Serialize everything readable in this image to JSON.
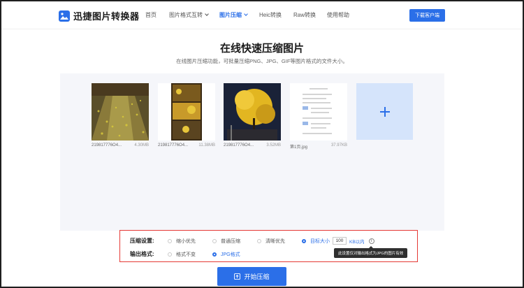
{
  "brand": {
    "name": "迅捷图片转换器",
    "accent": "#2b6fe8"
  },
  "nav": {
    "items": [
      {
        "label": "首页",
        "active": false,
        "dropdown": false
      },
      {
        "label": "图片格式互转",
        "active": false,
        "dropdown": true
      },
      {
        "label": "图片压缩",
        "active": true,
        "dropdown": true
      },
      {
        "label": "Heic转换",
        "active": false,
        "dropdown": false
      },
      {
        "label": "Raw转换",
        "active": false,
        "dropdown": false
      },
      {
        "label": "使用帮助",
        "active": false,
        "dropdown": false
      }
    ],
    "download_label": "下载客户端"
  },
  "main": {
    "title": "在线快速压缩图片",
    "subtitle": "在线图片压缩功能，可批量压缩PNG、JPG、GIF等图片格式的文件大小。"
  },
  "files": [
    {
      "name": "219817776O4...",
      "size": "4.30MB"
    },
    {
      "name": "219817776O4...",
      "size": "11.38MB"
    },
    {
      "name": "219817776O4...",
      "size": "3.52MB"
    },
    {
      "name": "第1页.jpg",
      "size": "37.97KB"
    }
  ],
  "settings": {
    "compress_label": "压缩设置:",
    "compress_options": [
      {
        "label": "缩小优先",
        "selected": false
      },
      {
        "label": "普通压缩",
        "selected": false
      },
      {
        "label": "清晰优先",
        "selected": false
      },
      {
        "label": "目标大小",
        "selected": true
      }
    ],
    "target_size_value": "100",
    "target_size_unit": "KB以内",
    "info_icon": "i",
    "output_label": "输出格式:",
    "output_options": [
      {
        "label": "格式不变",
        "selected": false
      },
      {
        "label": "JPG格式",
        "selected": true
      }
    ],
    "tooltip": "此设置仅对输出格式为JPG的图片有效"
  },
  "start_button_label": "开始压缩",
  "icons": {
    "logo": "image-icon",
    "add": "plus-icon",
    "start": "compress-icon",
    "info": "info-icon"
  }
}
